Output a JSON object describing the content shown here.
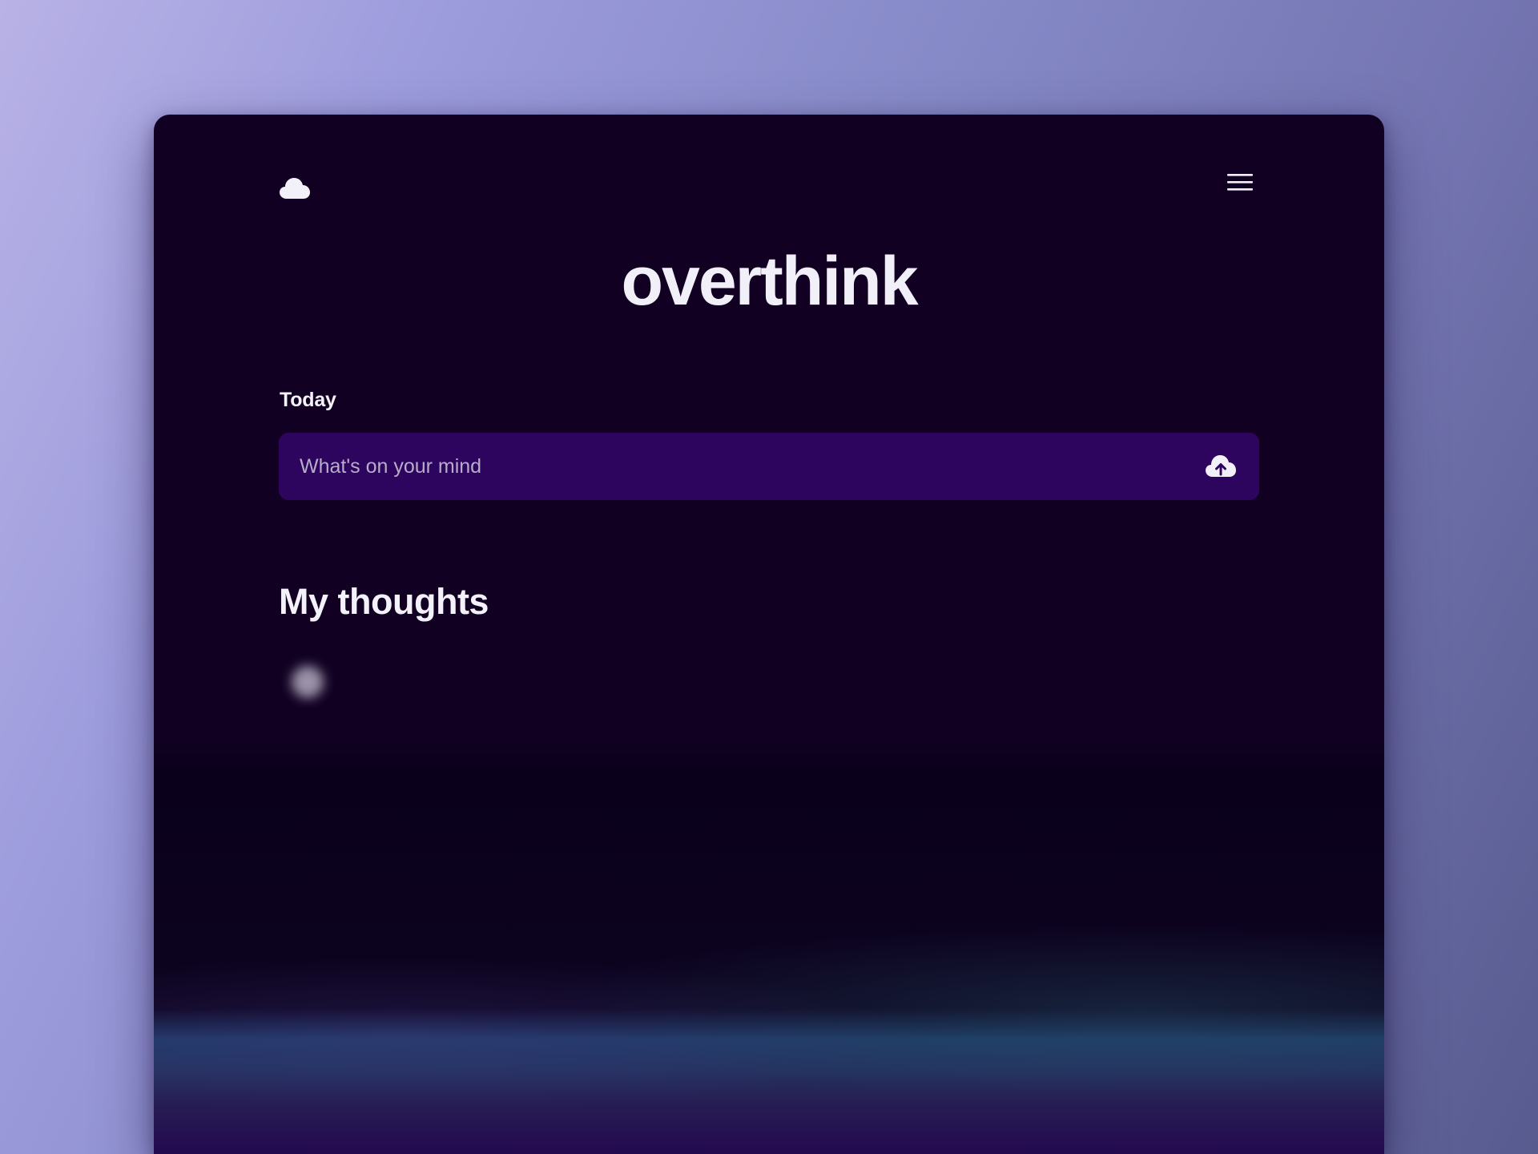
{
  "app": {
    "title": "overthink"
  },
  "header": {
    "logo_icon": "cloud-icon",
    "menu_icon": "hamburger-menu-icon"
  },
  "today": {
    "label": "Today",
    "input_placeholder": "What's on your mind",
    "input_value": "",
    "submit_icon": "cloud-upload-icon"
  },
  "thoughts": {
    "heading": "My thoughts",
    "items": [
      {
        "text": "",
        "meta": ""
      }
    ]
  },
  "colors": {
    "page_background": "#9c9bdc",
    "window_background": "#110022",
    "input_background": "#2e055e",
    "text_primary": "#f1eff8",
    "placeholder_text": "#b6adc9"
  }
}
